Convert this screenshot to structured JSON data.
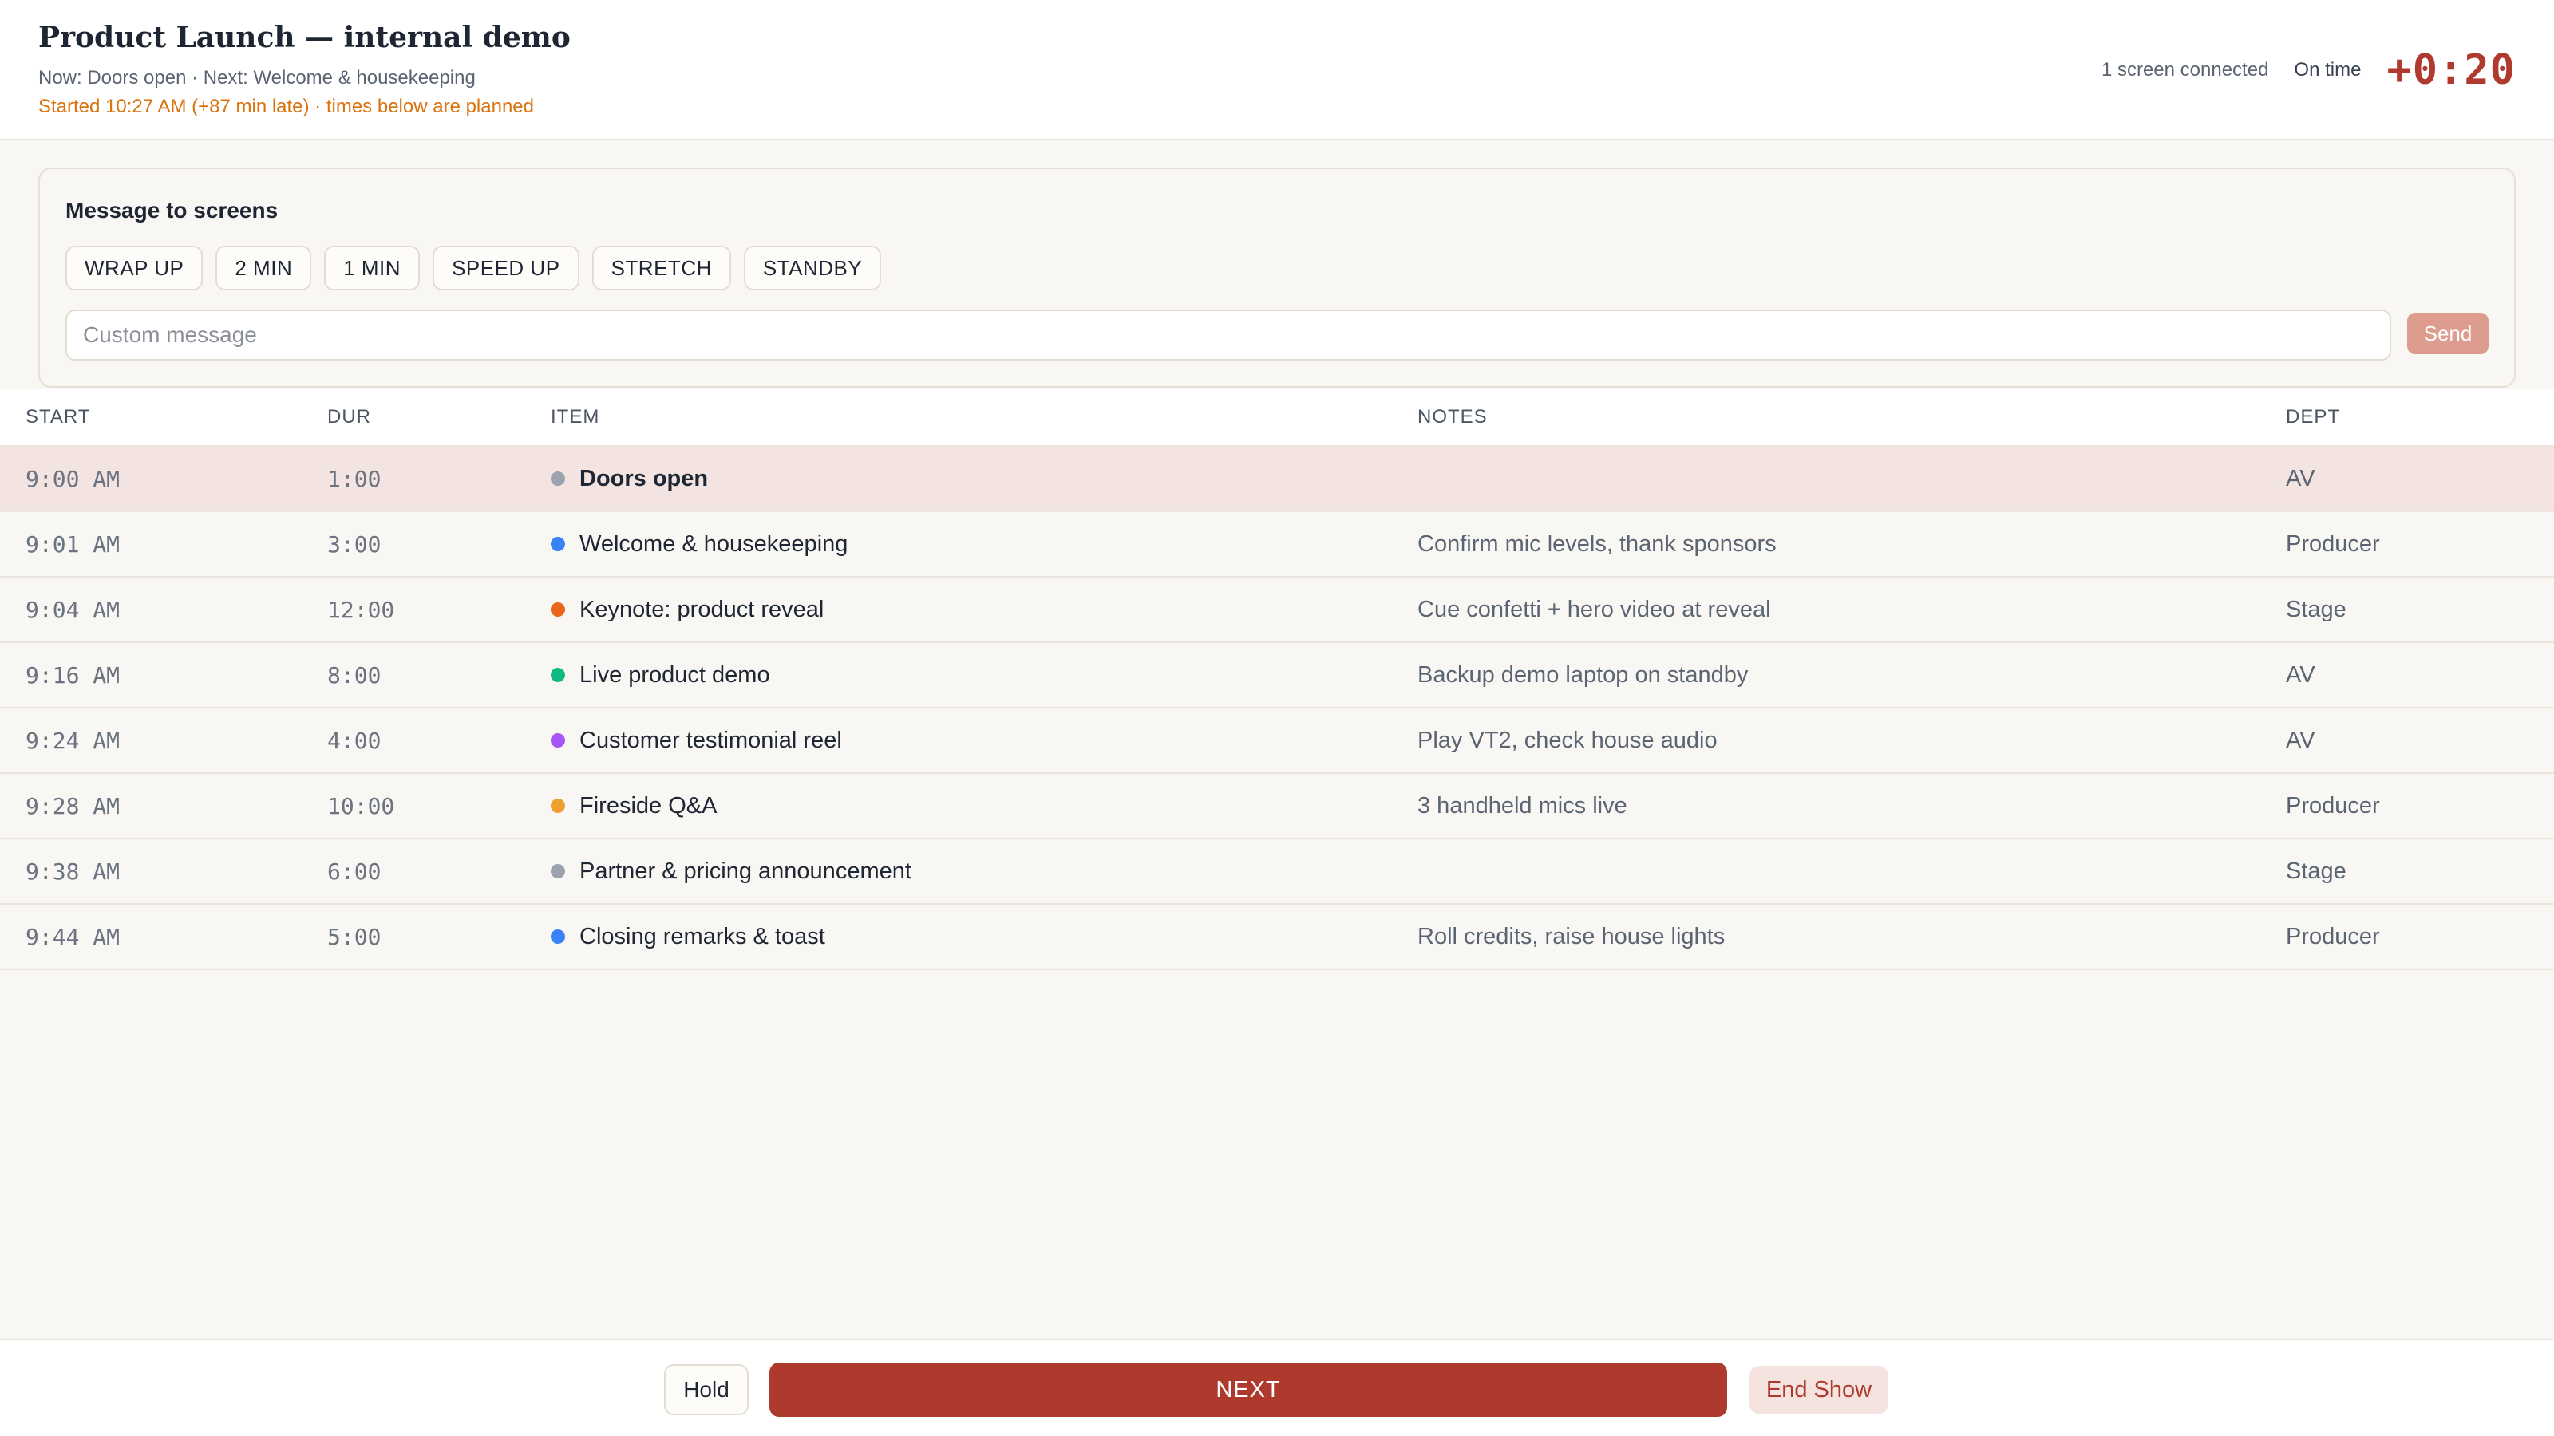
{
  "header": {
    "title": "Product Launch — internal demo",
    "now_next": "Now: Doors open · Next: Welcome & housekeeping",
    "late_notice": "Started 10:27 AM (+87 min late) · times below are planned",
    "screens_connected": "1 screen connected",
    "status": "On time",
    "offset": "+0:20"
  },
  "message_panel": {
    "title": "Message to screens",
    "presets": [
      "WRAP UP",
      "2 MIN",
      "1 MIN",
      "SPEED UP",
      "STRETCH",
      "STANDBY"
    ],
    "input_placeholder": "Custom message",
    "input_value": "",
    "send_label": "Send"
  },
  "table": {
    "columns": [
      "START",
      "DUR",
      "ITEM",
      "NOTES",
      "DEPT"
    ],
    "rows": [
      {
        "start": "9:00 AM",
        "dur": "1:00",
        "item": "Doors open",
        "notes": "",
        "dept": "AV",
        "color": "#9ca3af",
        "current": true
      },
      {
        "start": "9:01 AM",
        "dur": "3:00",
        "item": "Welcome & housekeeping",
        "notes": "Confirm mic levels, thank sponsors",
        "dept": "Producer",
        "color": "#3b82f6",
        "current": false
      },
      {
        "start": "9:04 AM",
        "dur": "12:00",
        "item": "Keynote: product reveal",
        "notes": "Cue confetti + hero video at reveal",
        "dept": "Stage",
        "color": "#e8671a",
        "current": false
      },
      {
        "start": "9:16 AM",
        "dur": "8:00",
        "item": "Live product demo",
        "notes": "Backup demo laptop on standby",
        "dept": "AV",
        "color": "#10b981",
        "current": false
      },
      {
        "start": "9:24 AM",
        "dur": "4:00",
        "item": "Customer testimonial reel",
        "notes": "Play VT2, check house audio",
        "dept": "AV",
        "color": "#a855f7",
        "current": false
      },
      {
        "start": "9:28 AM",
        "dur": "10:00",
        "item": "Fireside Q&A",
        "notes": "3 handheld mics live",
        "dept": "Producer",
        "color": "#f0a030",
        "current": false
      },
      {
        "start": "9:38 AM",
        "dur": "6:00",
        "item": "Partner & pricing announcement",
        "notes": "",
        "dept": "Stage",
        "color": "#9ca3af",
        "current": false
      },
      {
        "start": "9:44 AM",
        "dur": "5:00",
        "item": "Closing remarks & toast",
        "notes": "Roll credits, raise house lights",
        "dept": "Producer",
        "color": "#3b82f6",
        "current": false
      }
    ]
  },
  "footer": {
    "hold_label": "Hold",
    "next_label": "NEXT",
    "end_label": "End Show"
  },
  "colors": {
    "accent": "#ae3a2d",
    "late": "#d9730d",
    "current_row": "#f3e4e1"
  }
}
